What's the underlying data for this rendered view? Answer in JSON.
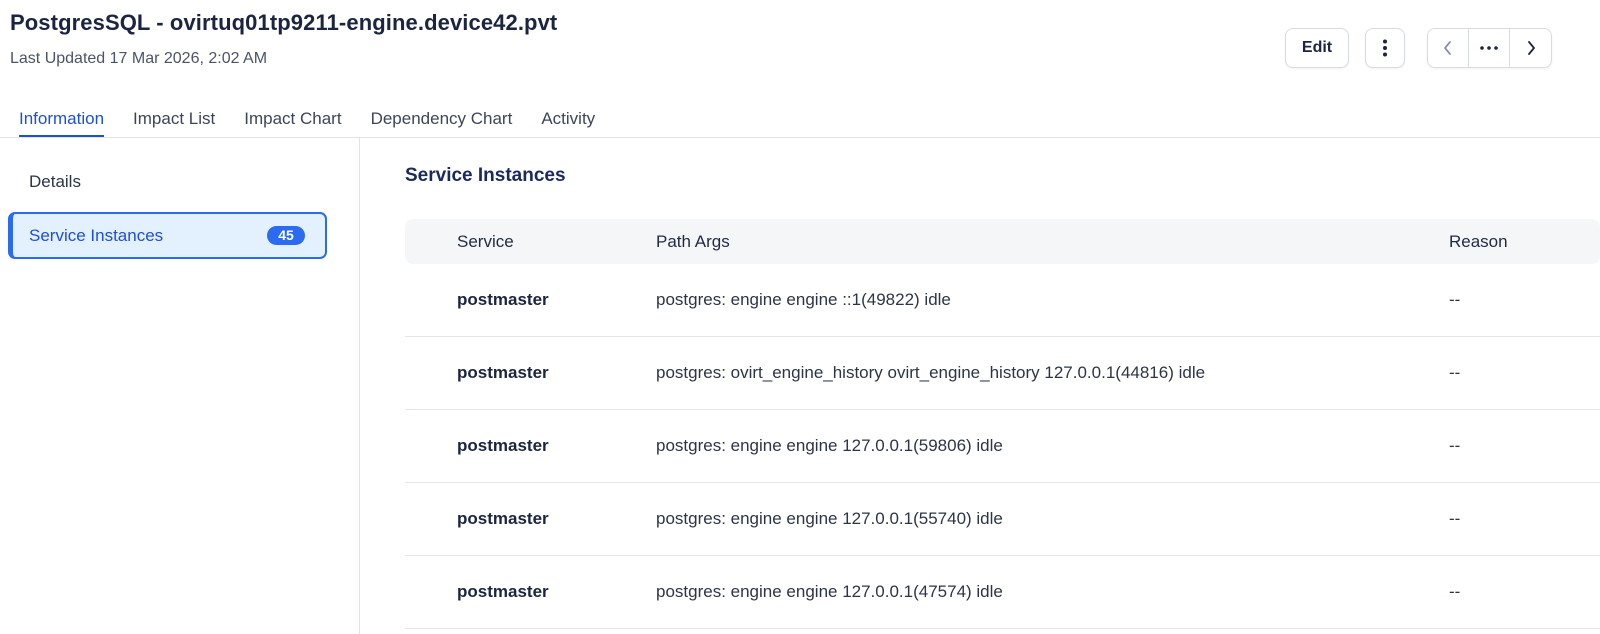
{
  "header": {
    "title": "PostgresSQL - ovirtuq01tp9211-engine.device42.pvt",
    "last_updated": "Last Updated 17 Mar 2026, 2:02 AM"
  },
  "actions": {
    "edit_label": "Edit",
    "more_icon": "vertical-ellipsis-icon",
    "prev_icon": "chevron-left-icon",
    "ellipsis_icon": "horizontal-ellipsis-icon",
    "next_icon": "chevron-right-icon"
  },
  "tabs": [
    {
      "label": "Information",
      "active": true
    },
    {
      "label": "Impact List"
    },
    {
      "label": "Impact Chart"
    },
    {
      "label": "Dependency Chart"
    },
    {
      "label": "Activity"
    }
  ],
  "sidebar": {
    "items": [
      {
        "label": "Details"
      },
      {
        "label": "Service Instances",
        "count": "45",
        "active": true
      }
    ]
  },
  "main": {
    "section_title": "Service Instances",
    "columns": {
      "service": "Service",
      "path_args": "Path Args",
      "reason": "Reason"
    },
    "rows": [
      {
        "service": "postmaster",
        "path_args": "postgres: engine engine ::1(49822) idle",
        "reason": "--"
      },
      {
        "service": "postmaster",
        "path_args": "postgres: ovirt_engine_history ovirt_engine_history 127.0.0.1(44816) idle",
        "reason": "--"
      },
      {
        "service": "postmaster",
        "path_args": "postgres: engine engine 127.0.0.1(59806) idle",
        "reason": "--"
      },
      {
        "service": "postmaster",
        "path_args": "postgres: engine engine 127.0.0.1(55740) idle",
        "reason": "--"
      },
      {
        "service": "postmaster",
        "path_args": "postgres: engine engine 127.0.0.1(47574) idle",
        "reason": "--"
      }
    ]
  },
  "colors": {
    "accent": "#1f4fd6",
    "badge": "#2a6bf0",
    "active_bg": "#e3f0fd"
  }
}
